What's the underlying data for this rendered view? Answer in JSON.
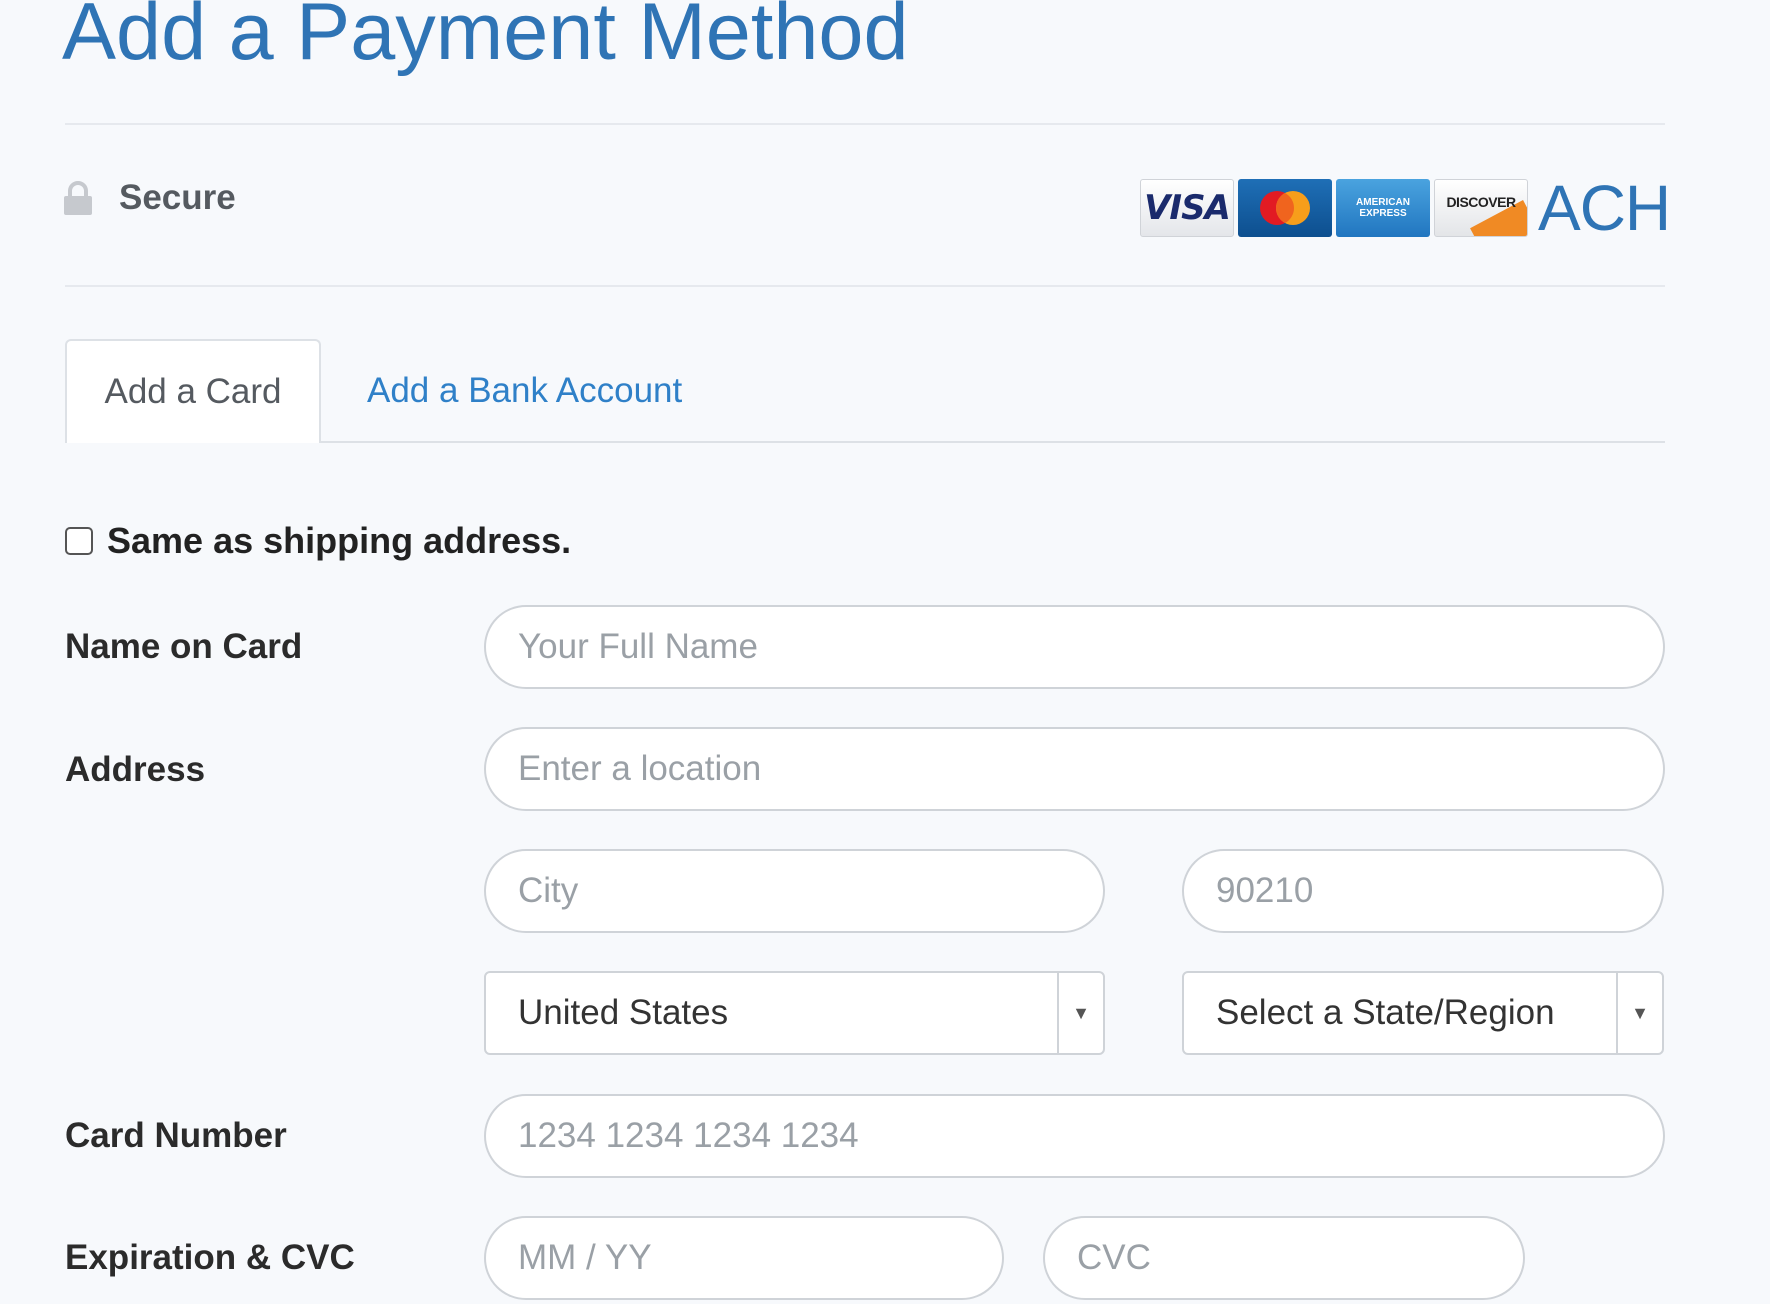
{
  "page": {
    "title": "Add a Payment Method"
  },
  "security": {
    "label": "Secure",
    "icon": "lock-icon"
  },
  "payment_logos": {
    "visa": "VISA",
    "mastercard": "MasterCard",
    "amex": "AMERICAN EXPRESS",
    "discover": "DISCOVER",
    "ach": "ACH"
  },
  "tabs": [
    {
      "label": "Add a Card",
      "active": true
    },
    {
      "label": "Add a Bank Account",
      "active": false
    }
  ],
  "form": {
    "same_as_shipping": {
      "label": "Same as shipping address.",
      "checked": false
    },
    "name_on_card": {
      "label": "Name on Card",
      "placeholder": "Your Full Name"
    },
    "address": {
      "label": "Address",
      "placeholder": "Enter a location",
      "city_placeholder": "City",
      "zip_placeholder": "90210",
      "country_value": "United States",
      "state_value": "Select a State/Region"
    },
    "card_number": {
      "label": "Card Number",
      "placeholder": "1234 1234 1234 1234"
    },
    "expiration_cvc": {
      "label": "Expiration & CVC",
      "exp_placeholder": "MM / YY",
      "cvc_placeholder": "CVC"
    }
  },
  "colors": {
    "accent": "#2f74b5",
    "link": "#2f80c8",
    "background": "#f7f9fc"
  }
}
